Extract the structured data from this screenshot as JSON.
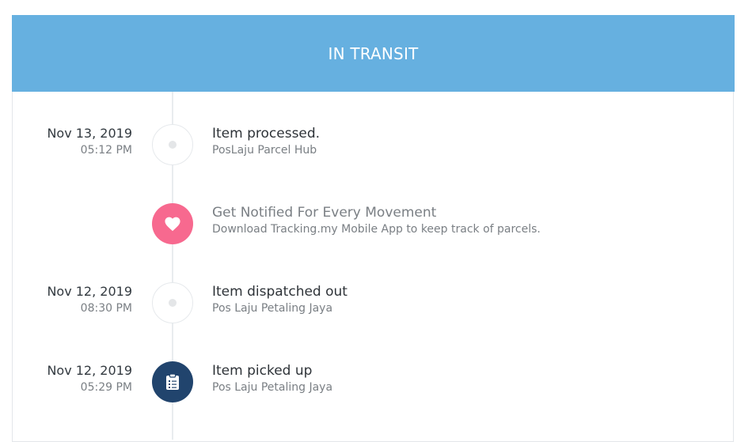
{
  "status": {
    "title": "IN TRANSIT",
    "color": "#66b0e0"
  },
  "events": [
    {
      "date": "Nov 13, 2019",
      "time": "05:12 PM",
      "title": "Item processed.",
      "location": "PosLaju Parcel Hub",
      "icon": "dot-icon"
    },
    {
      "date": "",
      "time": "",
      "title": "Get Notified For Every Movement",
      "location": "Download Tracking.my Mobile App to keep track of parcels.",
      "icon": "heart-icon",
      "color": "#f7698f"
    },
    {
      "date": "Nov 12, 2019",
      "time": "08:30 PM",
      "title": "Item dispatched out",
      "location": "Pos Laju Petaling Jaya",
      "icon": "dot-icon"
    },
    {
      "date": "Nov 12, 2019",
      "time": "05:29 PM",
      "title": "Item picked up",
      "location": "Pos Laju Petaling Jaya",
      "icon": "clipboard-list-icon",
      "color": "#21446d"
    }
  ]
}
